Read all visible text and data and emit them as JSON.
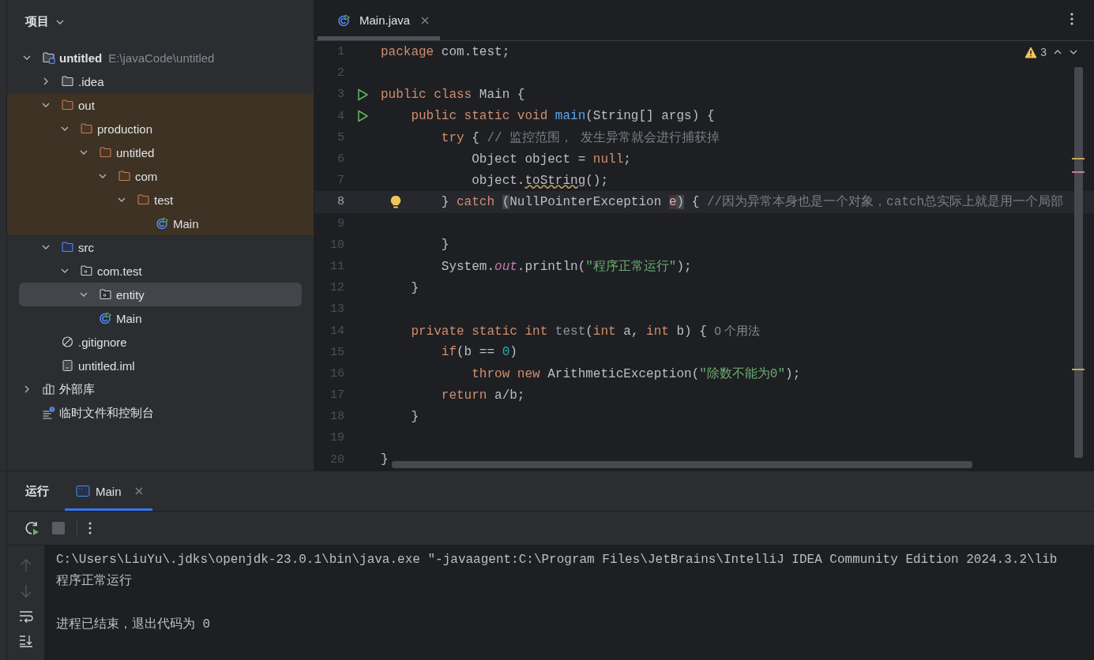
{
  "sidebar": {
    "title": "项目",
    "tree": [
      {
        "name": "untitled",
        "path": "E:\\javaCode\\untitled",
        "kind": "module",
        "expanded": true,
        "selected": false,
        "excluded": false,
        "children": [
          {
            "name": ".idea",
            "kind": "folder",
            "expanded": false,
            "selected": false,
            "excluded": false
          },
          {
            "name": "out",
            "kind": "folder",
            "expanded": true,
            "selected": false,
            "excluded": true,
            "children": [
              {
                "name": "production",
                "kind": "folder",
                "expanded": true,
                "selected": false,
                "excluded": true,
                "children": [
                  {
                    "name": "untitled",
                    "kind": "folder",
                    "expanded": true,
                    "selected": false,
                    "excluded": true,
                    "children": [
                      {
                        "name": "com",
                        "kind": "folder",
                        "expanded": true,
                        "selected": false,
                        "excluded": true,
                        "children": [
                          {
                            "name": "test",
                            "kind": "folder",
                            "expanded": true,
                            "selected": false,
                            "excluded": true,
                            "children": [
                              {
                                "name": "Main",
                                "kind": "class",
                                "selected": false,
                                "excluded": true
                              }
                            ]
                          }
                        ]
                      }
                    ]
                  }
                ]
              }
            ]
          },
          {
            "name": "src",
            "kind": "source-folder",
            "expanded": true,
            "selected": false,
            "excluded": false,
            "children": [
              {
                "name": "com.test",
                "kind": "package",
                "expanded": true,
                "selected": false,
                "excluded": false,
                "children": [
                  {
                    "name": "entity",
                    "kind": "package",
                    "expanded": true,
                    "selected": true,
                    "excluded": false
                  },
                  {
                    "name": "Main",
                    "kind": "class",
                    "selected": false,
                    "excluded": false
                  }
                ]
              }
            ]
          },
          {
            "name": ".gitignore",
            "kind": "ignore",
            "selected": false,
            "excluded": false
          },
          {
            "name": "untitled.iml",
            "kind": "iml",
            "selected": false,
            "excluded": false
          }
        ]
      },
      {
        "name": "外部库",
        "kind": "library",
        "expanded": false,
        "selected": false,
        "excluded": false
      },
      {
        "name": "临时文件和控制台",
        "kind": "scratch",
        "selected": false,
        "excluded": false
      }
    ]
  },
  "editor": {
    "tabs": [
      {
        "label": "Main.java",
        "selected": true
      }
    ],
    "inspections": {
      "warnings": "3"
    },
    "lines": [
      {
        "number": "1",
        "tokens": [
          {
            "kind": "keyword",
            "text": "package"
          },
          {
            "kind": "plain",
            "text": " com.test;"
          }
        ]
      },
      {
        "number": "2"
      },
      {
        "number": "3",
        "run": true,
        "tokens": [
          {
            "kind": "keyword",
            "text": "public class"
          },
          {
            "kind": "plain",
            "text": " Main {"
          }
        ]
      },
      {
        "number": "4",
        "run": true,
        "tokens": [
          {
            "kind": "keyword",
            "text": "    public static void "
          },
          {
            "kind": "method",
            "text": "main"
          },
          {
            "kind": "plain",
            "text": "(String[] args) {"
          }
        ]
      },
      {
        "number": "5",
        "tokens": [
          {
            "kind": "keyword",
            "text": "        try"
          },
          {
            "kind": "plain",
            "text": " { "
          },
          {
            "kind": "comment",
            "text": "// 监控范围， 发生异常就会进行捕获掉"
          }
        ]
      },
      {
        "number": "6",
        "tokens": [
          {
            "kind": "plain",
            "text": "            Object object = "
          },
          {
            "kind": "keyword",
            "text": "null"
          },
          {
            "kind": "plain",
            "text": ";"
          }
        ]
      },
      {
        "number": "7",
        "tokens": [
          {
            "kind": "plain",
            "text": "            object."
          },
          {
            "kind": "warn",
            "text": "toString"
          },
          {
            "kind": "plain",
            "text": "();"
          }
        ]
      },
      {
        "number": "8",
        "current": true,
        "bulb": true,
        "tokens": [
          {
            "kind": "plain",
            "text": "        } "
          },
          {
            "kind": "keyword",
            "text": "catch "
          },
          {
            "kind": "match",
            "text": "("
          },
          {
            "kind": "plain",
            "text": "NullPointerException "
          },
          {
            "kind": "flagged",
            "text": "e"
          },
          {
            "kind": "match",
            "text": ")"
          },
          {
            "kind": "plain",
            "text": " { "
          },
          {
            "kind": "comment",
            "text": "//因为异常本身也是一个对象，catch总实际上就是用一个局部"
          }
        ]
      },
      {
        "number": "9"
      },
      {
        "number": "10",
        "tokens": [
          {
            "kind": "plain",
            "text": "        }"
          }
        ]
      },
      {
        "number": "11",
        "tokens": [
          {
            "kind": "plain",
            "text": "        System."
          },
          {
            "kind": "field",
            "text": "out"
          },
          {
            "kind": "plain",
            "text": ".println("
          },
          {
            "kind": "string",
            "text": "\"程序正常运行\""
          },
          {
            "kind": "plain",
            "text": ");"
          }
        ]
      },
      {
        "number": "12",
        "tokens": [
          {
            "kind": "plain",
            "text": "    }"
          }
        ]
      },
      {
        "number": "13"
      },
      {
        "number": "14",
        "tokens": [
          {
            "kind": "keyword",
            "text": "    private static int "
          },
          {
            "kind": "unused",
            "text": "test"
          },
          {
            "kind": "plain",
            "text": "("
          },
          {
            "kind": "keyword",
            "text": "int"
          },
          {
            "kind": "plain",
            "text": " a, "
          },
          {
            "kind": "keyword",
            "text": "int"
          },
          {
            "kind": "plain",
            "text": " b) { "
          },
          {
            "kind": "hint",
            "text": "0 个用法"
          }
        ]
      },
      {
        "number": "15",
        "tokens": [
          {
            "kind": "keyword",
            "text": "        if"
          },
          {
            "kind": "plain",
            "text": "(b == "
          },
          {
            "kind": "number",
            "text": "0"
          },
          {
            "kind": "plain",
            "text": ")"
          }
        ]
      },
      {
        "number": "16",
        "tokens": [
          {
            "kind": "keyword",
            "text": "            throw new "
          },
          {
            "kind": "plain",
            "text": "ArithmeticException("
          },
          {
            "kind": "string",
            "text": "\"除数不能为0\""
          },
          {
            "kind": "plain",
            "text": ");"
          }
        ]
      },
      {
        "number": "17",
        "tokens": [
          {
            "kind": "keyword",
            "text": "        return"
          },
          {
            "kind": "plain",
            "text": " a/b;"
          }
        ]
      },
      {
        "number": "18",
        "tokens": [
          {
            "kind": "plain",
            "text": "    }"
          }
        ]
      },
      {
        "number": "19"
      },
      {
        "number": "20",
        "tokens": [
          {
            "kind": "plain",
            "text": "}"
          }
        ]
      }
    ]
  },
  "run_panel": {
    "title": "运行",
    "tabs": [
      {
        "label": "Main",
        "selected": true
      }
    ],
    "console": [
      {
        "kind": "command",
        "text": "C:\\Users\\LiuYu\\.jdks\\openjdk-23.0.1\\bin\\java.exe \"-javaagent:C:\\Program Files\\JetBrains\\IntelliJ IDEA Community Edition 2024.3.2\\lib"
      },
      {
        "kind": "output",
        "text": "程序正常运行"
      },
      {
        "kind": "status",
        "text": "进程已结束，退出代码为 0"
      }
    ]
  }
}
